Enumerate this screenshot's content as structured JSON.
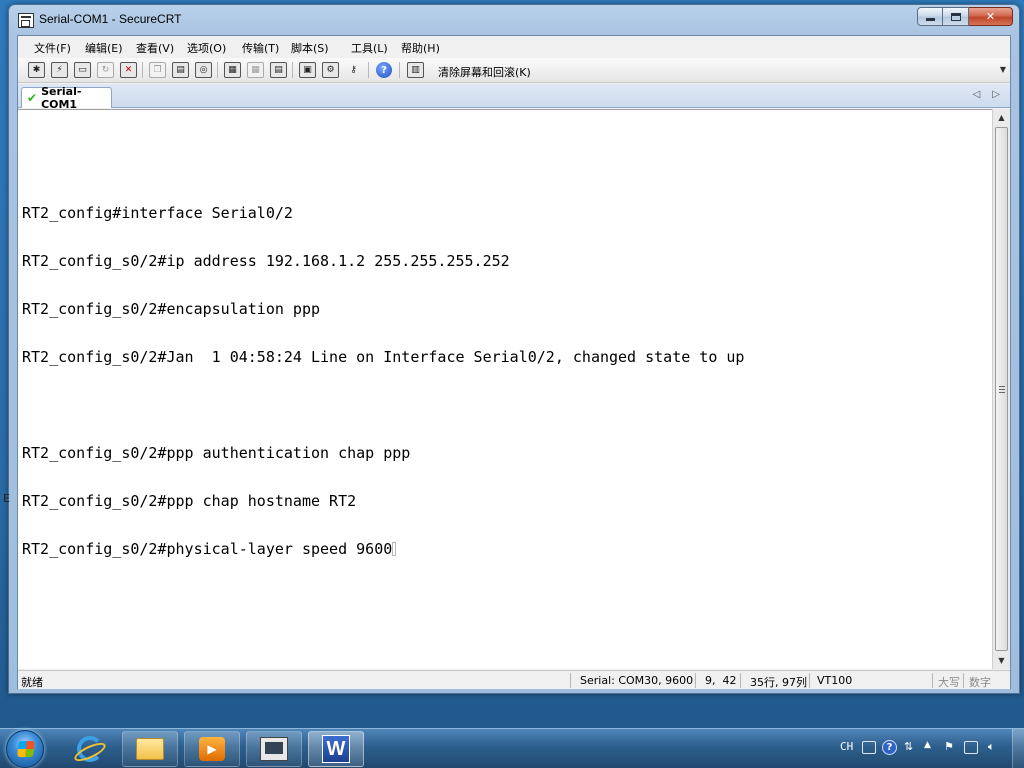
{
  "window": {
    "title": "Serial-COM1 - SecureCRT",
    "controls": {
      "minimize": "minimize",
      "maximize": "maximize",
      "close": "✕"
    }
  },
  "menu": [
    "文件(F)",
    "编辑(E)",
    "查看(V)",
    "选项(O)",
    "传输(T)",
    "脚本(S)",
    "工具(L)",
    "帮助(H)"
  ],
  "toolbar": {
    "clear_label": "清除屏幕和回滚(K)",
    "icons": [
      "connect-icon",
      "quick-connect-icon",
      "connect-tab-icon",
      "reconnect-icon",
      "disconnect-icon",
      "copy-icon",
      "paste-icon",
      "find-icon",
      "print-icon",
      "print-setup-icon",
      "print-selection-icon",
      "session-options-icon",
      "global-options-icon",
      "keymap-icon",
      "help-icon",
      "clear-screen-icon"
    ]
  },
  "tabs": [
    {
      "label": "Serial-COM1",
      "status": "connected"
    }
  ],
  "terminal": {
    "lines": [
      "",
      "RT2_config#interface Serial0/2",
      "RT2_config_s0/2#ip address 192.168.1.2 255.255.255.252",
      "RT2_config_s0/2#encapsulation ppp",
      "RT2_config_s0/2#Jan  1 04:58:24 Line on Interface Serial0/2, changed state to up",
      "",
      "RT2_config_s0/2#ppp authentication chap ppp",
      "RT2_config_s0/2#ppp chap hostname RT2",
      "RT2_config_s0/2#physical-layer speed 9600"
    ]
  },
  "status": {
    "ready": "就绪",
    "serial": "Serial: COM30, 9600",
    "cursor_pos": "9,  42",
    "dims": "35行, 97列",
    "emulation": "VT100",
    "caps": "大写",
    "num": "数字"
  },
  "side_mark": "E",
  "taskbar": {
    "apps": [
      "internet-explorer",
      "file-explorer",
      "media-player",
      "securecrt",
      "wps-writer"
    ],
    "tray": {
      "ime": "CH",
      "help": "?"
    }
  }
}
